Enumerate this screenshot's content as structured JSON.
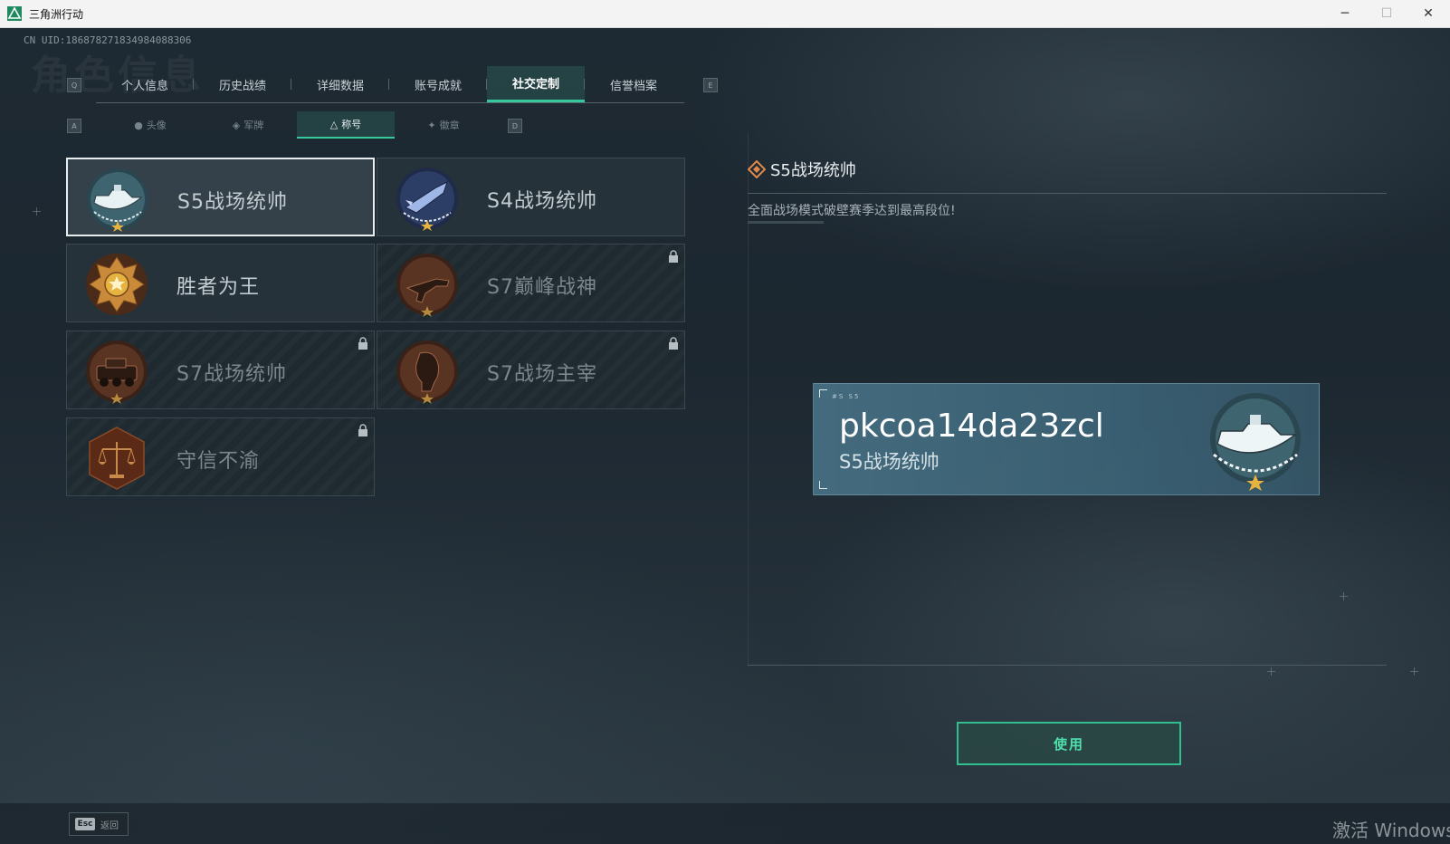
{
  "window": {
    "title": "三角洲行动",
    "min_label": "─",
    "max_label": "☐",
    "close_label": "✕"
  },
  "header": {
    "uid": "CN UID:18687827183498408830​6",
    "watermark": "角色信息"
  },
  "tabs": {
    "prev_key": "Q",
    "next_key": "E",
    "items": [
      {
        "label": "个人信息"
      },
      {
        "label": "历史战绩"
      },
      {
        "label": "详细数据"
      },
      {
        "label": "账号成就"
      },
      {
        "label": "社交定制",
        "active": true
      },
      {
        "label": "信誉档案"
      }
    ]
  },
  "subtabs": {
    "prev_key": "A",
    "next_key": "D",
    "items": [
      {
        "label": "头像",
        "icon": "person-icon"
      },
      {
        "label": "军牌",
        "icon": "dogtag-icon"
      },
      {
        "label": "称号",
        "icon": "triangle-icon",
        "active": true
      },
      {
        "label": "徽章",
        "icon": "emblem-icon"
      }
    ]
  },
  "titles": [
    {
      "label": "S5战场统帅",
      "badge": "boat-badge",
      "locked": false,
      "selected": true
    },
    {
      "label": "S4战场统帅",
      "badge": "missile-badge",
      "locked": false,
      "selected": false
    },
    {
      "label": "胜者为王",
      "badge": "medal-badge",
      "locked": false,
      "selected": false
    },
    {
      "label": "S7巅峰战神",
      "badge": "gun-badge",
      "locked": true,
      "selected": false
    },
    {
      "label": "S7战场统帅",
      "badge": "tank-badge",
      "locked": true,
      "selected": false
    },
    {
      "label": "S7战场主宰",
      "badge": "warrior-badge",
      "locked": true,
      "selected": false
    },
    {
      "label": "守信不渝",
      "badge": "scales-badge",
      "locked": true,
      "selected": false
    }
  ],
  "detail": {
    "title": "S5战场统帅",
    "description": "全面战场模式破壁赛季达到最高段位!"
  },
  "nameplate": {
    "tag": "#S  S5",
    "player_name": "pkcoa14da23zcl",
    "title": "S5战场统帅"
  },
  "use_button": {
    "label": "使用"
  },
  "footer": {
    "esc_key": "Esc",
    "esc_label": "返回"
  },
  "os_watermark": "激活 Windows",
  "colors": {
    "accent": "#36c79a",
    "button_text": "#4fe0ad",
    "background": "#1c2730"
  }
}
